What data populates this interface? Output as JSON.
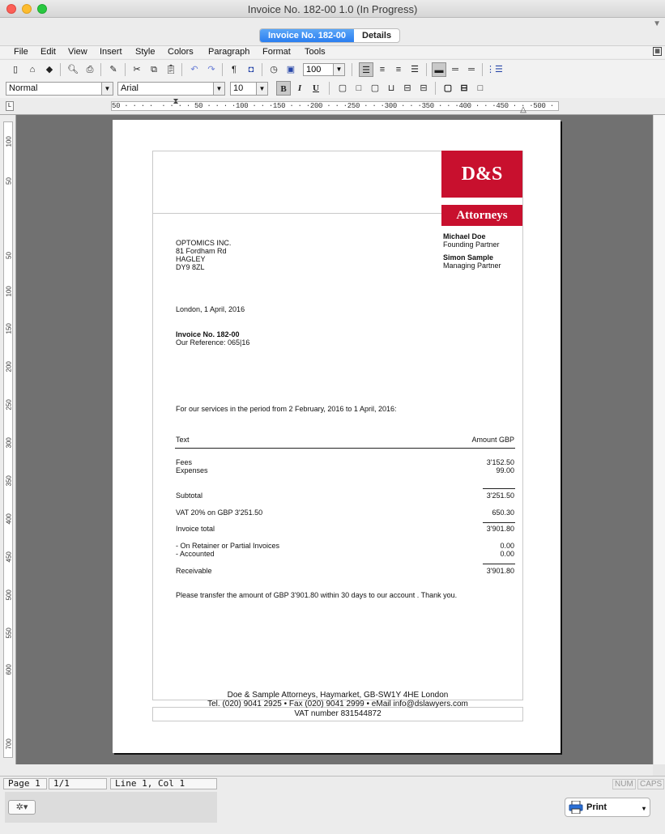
{
  "window": {
    "title": "Invoice No. 182-00 1.0 (In Progress)"
  },
  "tabs": [
    {
      "label": "Invoice No. 182-00",
      "active": true
    },
    {
      "label": "Details",
      "active": false
    }
  ],
  "menu": [
    "File",
    "Edit",
    "View",
    "Insert",
    "Style",
    "Colors",
    "Paragraph",
    "Format",
    "Tools"
  ],
  "toolbar": {
    "zoom": "100",
    "paragraph_style": "Normal",
    "font": "Arial",
    "size": "10",
    "bold": "B",
    "italic": "I",
    "underline": "U",
    "pilcrow": "¶"
  },
  "ruler": {
    "h_ticks": "50 · · · ·  · · · · 50 · · · ·100 · · ·150 · · ·200 · · ·250 · · ·300 · · ·350 · · ·400 · · ·450 · · ·500 · ·",
    "v_ticks": [
      "100",
      "50",
      "50",
      "100",
      "150",
      "200",
      "250",
      "300",
      "350",
      "400",
      "450",
      "500",
      "550",
      "600",
      "700"
    ]
  },
  "document": {
    "logo_top": "D&S",
    "logo_bottom": "Attorneys",
    "recipient": [
      "OPTOMICS INC.",
      "81 Fordham Rd",
      "HAGLEY",
      "DY9 8ZL"
    ],
    "partners": [
      {
        "name": "Michael Doe",
        "title": "Founding Partner"
      },
      {
        "name": "Simon Sample",
        "title": "Managing Partner"
      }
    ],
    "place_date": "London, 1 April, 2016",
    "invoice_no": "Invoice No. 182-00",
    "reference": "Our Reference: 065|16",
    "period": "For our services in the period from 2 February, 2016 to 1 April, 2016:",
    "table_header": {
      "text": "Text",
      "amount": "Amount GBP"
    },
    "fees": {
      "label": "Fees",
      "amount": "3'152.50"
    },
    "expenses": {
      "label": "Expenses",
      "amount": "99.00"
    },
    "subtotal": {
      "label": "Subtotal",
      "amount": "3'251.50"
    },
    "vat": {
      "label": "VAT 20% on GBP 3'251.50",
      "amount": "650.30"
    },
    "invoice_total": {
      "label": "Invoice total",
      "amount": "3'901.80"
    },
    "retainer": {
      "label": "- On Retainer or Partial Invoices",
      "amount": "0.00"
    },
    "accounted": {
      "label": "- Accounted",
      "amount": "0.00"
    },
    "receivable": {
      "label": "Receivable",
      "amount": "3'901.80"
    },
    "transfer_note": "Please transfer the amount of GBP 3'901.80 within 30 days to our account . Thank you.",
    "footer_line1": "Doe & Sample Attorneys, Haymarket, GB-SW1Y 4HE London",
    "footer_line2": "Tel. (020) 9041 2925 • Fax (020) 9041 2999  • eMail info@dslawyers.com",
    "footer_line3": "VAT number 831544872"
  },
  "status": {
    "page": "Page 1",
    "pages": "1/1",
    "position": "Line 1, Col 1",
    "num": "NUM",
    "caps": "CAPS"
  },
  "bottom": {
    "gear": "✲▾",
    "print": "Print"
  },
  "colors": {
    "brand_red": "#c8102e",
    "tab_active": "#2a7ef0"
  }
}
